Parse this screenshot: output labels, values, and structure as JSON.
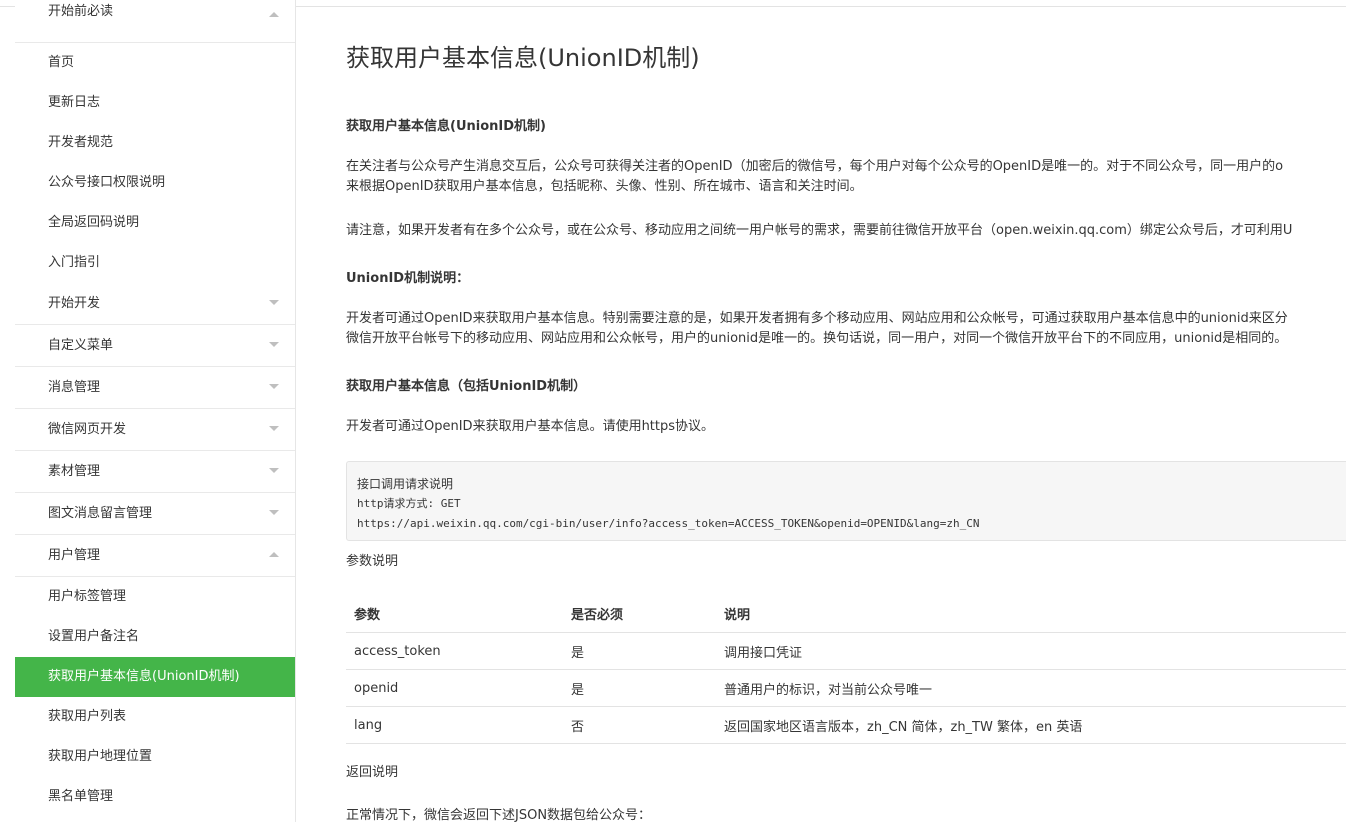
{
  "sidebar": {
    "items": [
      {
        "label": "开始前必读",
        "type": "group",
        "caret": "up"
      },
      {
        "label": "首页",
        "type": "item"
      },
      {
        "label": "更新日志",
        "type": "item"
      },
      {
        "label": "开发者规范",
        "type": "item"
      },
      {
        "label": "公众号接口权限说明",
        "type": "item"
      },
      {
        "label": "全局返回码说明",
        "type": "item"
      },
      {
        "label": "入门指引",
        "type": "item"
      },
      {
        "label": "开始开发",
        "type": "group",
        "caret": "down"
      },
      {
        "label": "自定义菜单",
        "type": "group",
        "caret": "down"
      },
      {
        "label": "消息管理",
        "type": "group",
        "caret": "down"
      },
      {
        "label": "微信网页开发",
        "type": "group",
        "caret": "down"
      },
      {
        "label": "素材管理",
        "type": "group",
        "caret": "down"
      },
      {
        "label": "图文消息留言管理",
        "type": "group",
        "caret": "down"
      },
      {
        "label": "用户管理",
        "type": "group",
        "caret": "up"
      },
      {
        "label": "用户标签管理",
        "type": "item"
      },
      {
        "label": "设置用户备注名",
        "type": "item"
      },
      {
        "label": "获取用户基本信息(UnionID机制)",
        "type": "item",
        "active": true
      },
      {
        "label": "获取用户列表",
        "type": "item"
      },
      {
        "label": "获取用户地理位置",
        "type": "item"
      },
      {
        "label": "黑名单管理",
        "type": "item"
      }
    ]
  },
  "main": {
    "title": "获取用户基本信息(UnionID机制)",
    "section1_heading": "获取用户基本信息(UnionID机制)",
    "para1_line1": "在关注者与公众号产生消息交互后，公众号可获得关注者的OpenID（加密后的微信号，每个用户对每个公众号的OpenID是唯一的。对于不同公众号，同一用户的o",
    "para1_line2": "来根据OpenID获取用户基本信息，包括昵称、头像、性别、所在城市、语言和关注时间。",
    "para2": "请注意，如果开发者有在多个公众号，或在公众号、移动应用之间统一用户帐号的需求，需要前往微信开放平台（open.weixin.qq.com）绑定公众号后，才可利用U",
    "section2_heading": "UnionID机制说明：",
    "para3_line1": "开发者可通过OpenID来获取用户基本信息。特别需要注意的是，如果开发者拥有多个移动应用、网站应用和公众帐号，可通过获取用户基本信息中的unionid来区分",
    "para3_line2": "微信开放平台帐号下的移动应用、网站应用和公众帐号，用户的unionid是唯一的。换句话说，同一用户，对同一个微信开放平台下的不同应用，unionid是相同的。",
    "section3_heading": "获取用户基本信息（包括UnionID机制）",
    "para4": "开发者可通过OpenID来获取用户基本信息。请使用https协议。",
    "code": {
      "line1": "接口调用请求说明",
      "line2": "http请求方式: GET",
      "line3": "https://api.weixin.qq.com/cgi-bin/user/info?access_token=ACCESS_TOKEN&openid=OPENID&lang=zh_CN"
    },
    "params_label": "参数说明",
    "table": {
      "headers": [
        "参数",
        "是否必须",
        "说明"
      ],
      "rows": [
        [
          "access_token",
          "是",
          "调用接口凭证"
        ],
        [
          "openid",
          "是",
          "普通用户的标识，对当前公众号唯一"
        ],
        [
          "lang",
          "否",
          "返回国家地区语言版本，zh_CN 简体，zh_TW 繁体，en 英语"
        ]
      ]
    },
    "return_label": "返回说明",
    "para5": "正常情况下，微信会返回下述JSON数据包给公众号："
  },
  "colors": {
    "active_bg": "#44b549",
    "text": "#353535",
    "border": "#e3e3e3",
    "code_bg": "#f6f6f6"
  }
}
